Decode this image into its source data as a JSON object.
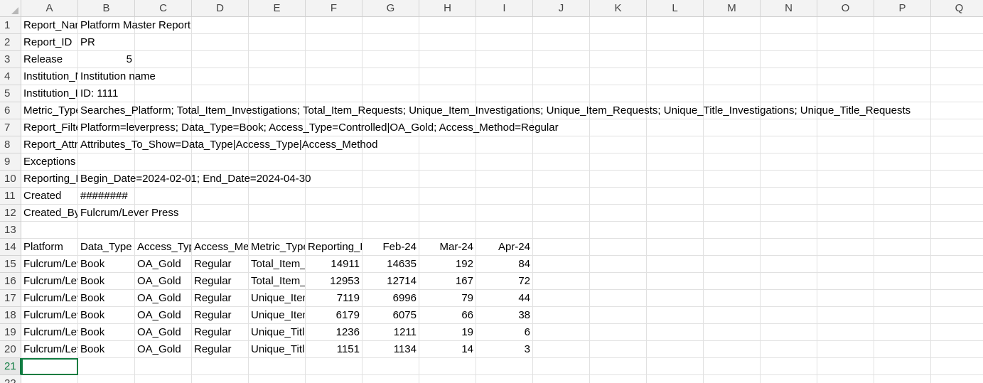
{
  "columns": [
    "A",
    "B",
    "C",
    "D",
    "E",
    "F",
    "G",
    "H",
    "I",
    "J",
    "K",
    "L",
    "M",
    "N",
    "O",
    "P",
    "Q"
  ],
  "rows": [
    {
      "n": "1",
      "cells": [
        {
          "c": 0,
          "v": "Report_Name"
        },
        {
          "c": 1,
          "v": "Platform Master Report",
          "spill": true
        }
      ]
    },
    {
      "n": "2",
      "cells": [
        {
          "c": 0,
          "v": "Report_ID"
        },
        {
          "c": 1,
          "v": "PR"
        }
      ]
    },
    {
      "n": "3",
      "cells": [
        {
          "c": 0,
          "v": "Release"
        },
        {
          "c": 1,
          "v": "5",
          "num": true
        }
      ]
    },
    {
      "n": "4",
      "cells": [
        {
          "c": 0,
          "v": "Institution_Name"
        },
        {
          "c": 1,
          "v": "Institution name",
          "spill": true
        }
      ]
    },
    {
      "n": "5",
      "cells": [
        {
          "c": 0,
          "v": "Institution_ID"
        },
        {
          "c": 1,
          "v": "ID: 1111"
        }
      ]
    },
    {
      "n": "6",
      "cells": [
        {
          "c": 0,
          "v": "Metric_Types"
        },
        {
          "c": 1,
          "v": "Searches_Platform; Total_Item_Investigations; Total_Item_Requests; Unique_Item_Investigations; Unique_Item_Requests; Unique_Title_Investigations; Unique_Title_Requests",
          "spill": true
        }
      ]
    },
    {
      "n": "7",
      "cells": [
        {
          "c": 0,
          "v": "Report_Filters"
        },
        {
          "c": 1,
          "v": "Platform=leverpress; Data_Type=Book; Access_Type=Controlled|OA_Gold; Access_Method=Regular",
          "spill": true
        }
      ]
    },
    {
      "n": "8",
      "cells": [
        {
          "c": 0,
          "v": "Report_Attributes"
        },
        {
          "c": 1,
          "v": "Attributes_To_Show=Data_Type|Access_Type|Access_Method",
          "spill": true
        }
      ]
    },
    {
      "n": "9",
      "cells": [
        {
          "c": 0,
          "v": "Exceptions"
        }
      ]
    },
    {
      "n": "10",
      "cells": [
        {
          "c": 0,
          "v": "Reporting_Period"
        },
        {
          "c": 1,
          "v": "Begin_Date=2024-02-01; End_Date=2024-04-30",
          "spill": true
        }
      ]
    },
    {
      "n": "11",
      "cells": [
        {
          "c": 0,
          "v": "Created"
        },
        {
          "c": 1,
          "v": "########"
        }
      ]
    },
    {
      "n": "12",
      "cells": [
        {
          "c": 0,
          "v": "Created_By"
        },
        {
          "c": 1,
          "v": "Fulcrum/Lever Press",
          "spill": true
        }
      ]
    },
    {
      "n": "13",
      "cells": []
    },
    {
      "n": "14",
      "cells": [
        {
          "c": 0,
          "v": "Platform"
        },
        {
          "c": 1,
          "v": "Data_Type"
        },
        {
          "c": 2,
          "v": "Access_Type"
        },
        {
          "c": 3,
          "v": "Access_Method"
        },
        {
          "c": 4,
          "v": "Metric_Type"
        },
        {
          "c": 5,
          "v": "Reporting_Period_Total"
        },
        {
          "c": 6,
          "v": "Feb-24",
          "num": true
        },
        {
          "c": 7,
          "v": "Mar-24",
          "num": true
        },
        {
          "c": 8,
          "v": "Apr-24",
          "num": true
        }
      ]
    },
    {
      "n": "15",
      "cells": [
        {
          "c": 0,
          "v": "Fulcrum/Lever Press"
        },
        {
          "c": 1,
          "v": "Book"
        },
        {
          "c": 2,
          "v": "OA_Gold"
        },
        {
          "c": 3,
          "v": "Regular"
        },
        {
          "c": 4,
          "v": "Total_Item_Investigations"
        },
        {
          "c": 5,
          "v": "14911",
          "num": true
        },
        {
          "c": 6,
          "v": "14635",
          "num": true
        },
        {
          "c": 7,
          "v": "192",
          "num": true
        },
        {
          "c": 8,
          "v": "84",
          "num": true
        }
      ]
    },
    {
      "n": "16",
      "cells": [
        {
          "c": 0,
          "v": "Fulcrum/Lever Press"
        },
        {
          "c": 1,
          "v": "Book"
        },
        {
          "c": 2,
          "v": "OA_Gold"
        },
        {
          "c": 3,
          "v": "Regular"
        },
        {
          "c": 4,
          "v": "Total_Item_Requests"
        },
        {
          "c": 5,
          "v": "12953",
          "num": true
        },
        {
          "c": 6,
          "v": "12714",
          "num": true
        },
        {
          "c": 7,
          "v": "167",
          "num": true
        },
        {
          "c": 8,
          "v": "72",
          "num": true
        }
      ]
    },
    {
      "n": "17",
      "cells": [
        {
          "c": 0,
          "v": "Fulcrum/Lever Press"
        },
        {
          "c": 1,
          "v": "Book"
        },
        {
          "c": 2,
          "v": "OA_Gold"
        },
        {
          "c": 3,
          "v": "Regular"
        },
        {
          "c": 4,
          "v": "Unique_Item_Investigations"
        },
        {
          "c": 5,
          "v": "7119",
          "num": true
        },
        {
          "c": 6,
          "v": "6996",
          "num": true
        },
        {
          "c": 7,
          "v": "79",
          "num": true
        },
        {
          "c": 8,
          "v": "44",
          "num": true
        }
      ]
    },
    {
      "n": "18",
      "cells": [
        {
          "c": 0,
          "v": "Fulcrum/Lever Press"
        },
        {
          "c": 1,
          "v": "Book"
        },
        {
          "c": 2,
          "v": "OA_Gold"
        },
        {
          "c": 3,
          "v": "Regular"
        },
        {
          "c": 4,
          "v": "Unique_Item_Requests"
        },
        {
          "c": 5,
          "v": "6179",
          "num": true
        },
        {
          "c": 6,
          "v": "6075",
          "num": true
        },
        {
          "c": 7,
          "v": "66",
          "num": true
        },
        {
          "c": 8,
          "v": "38",
          "num": true
        }
      ]
    },
    {
      "n": "19",
      "cells": [
        {
          "c": 0,
          "v": "Fulcrum/Lever Press"
        },
        {
          "c": 1,
          "v": "Book"
        },
        {
          "c": 2,
          "v": "OA_Gold"
        },
        {
          "c": 3,
          "v": "Regular"
        },
        {
          "c": 4,
          "v": "Unique_Title_Investigations"
        },
        {
          "c": 5,
          "v": "1236",
          "num": true
        },
        {
          "c": 6,
          "v": "1211",
          "num": true
        },
        {
          "c": 7,
          "v": "19",
          "num": true
        },
        {
          "c": 8,
          "v": "6",
          "num": true
        }
      ]
    },
    {
      "n": "20",
      "cells": [
        {
          "c": 0,
          "v": "Fulcrum/Lever Press"
        },
        {
          "c": 1,
          "v": "Book"
        },
        {
          "c": 2,
          "v": "OA_Gold"
        },
        {
          "c": 3,
          "v": "Regular"
        },
        {
          "c": 4,
          "v": "Unique_Title_Requests"
        },
        {
          "c": 5,
          "v": "1151",
          "num": true
        },
        {
          "c": 6,
          "v": "1134",
          "num": true
        },
        {
          "c": 7,
          "v": "14",
          "num": true
        },
        {
          "c": 8,
          "v": "3",
          "num": true
        }
      ]
    },
    {
      "n": "21",
      "cells": [],
      "active": true
    },
    {
      "n": "22",
      "cells": []
    }
  ],
  "selected_cell": {
    "row": "21",
    "col": "A"
  },
  "colors": {
    "accent": "#107c41",
    "header_bg": "#f3f3f3",
    "gridline": "#e1e1e1"
  }
}
